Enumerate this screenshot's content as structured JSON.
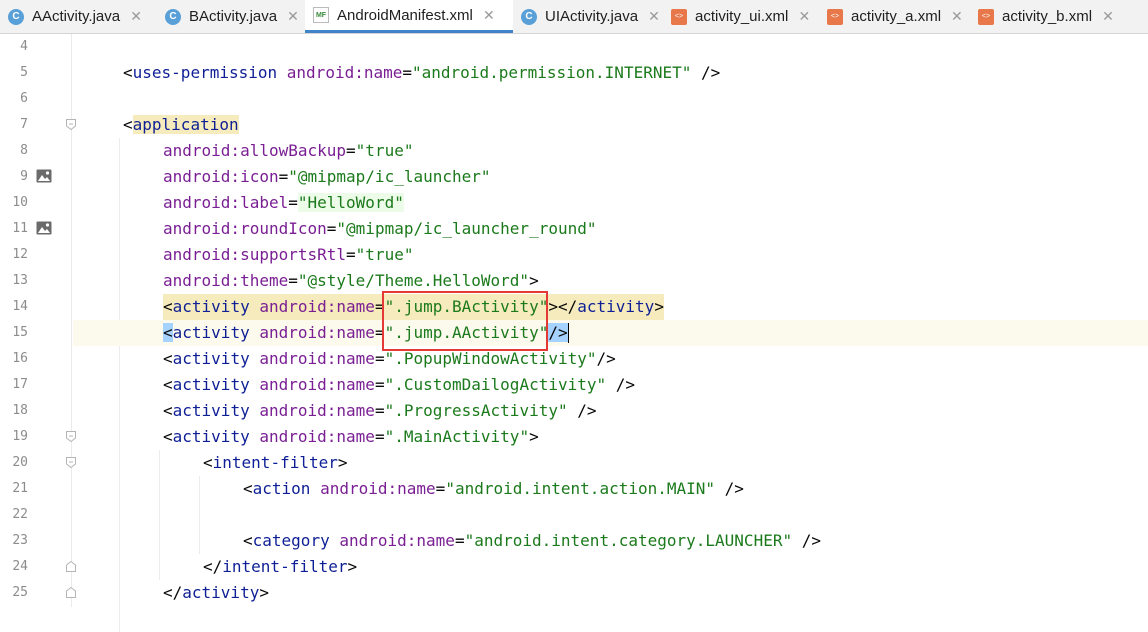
{
  "tabs": [
    {
      "label": "AActivity.java",
      "icon": "java-class-icon",
      "active": false
    },
    {
      "label": "BActivity.java",
      "icon": "java-class-icon",
      "active": false
    },
    {
      "label": "AndroidManifest.xml",
      "icon": "manifest-icon",
      "active": true
    },
    {
      "label": "UIActivity.java",
      "icon": "java-class-icon",
      "active": false
    },
    {
      "label": "activity_ui.xml",
      "icon": "xml-layout-icon",
      "active": false
    },
    {
      "label": "activity_a.xml",
      "icon": "xml-layout-icon",
      "active": false
    },
    {
      "label": "activity_b.xml",
      "icon": "xml-layout-icon",
      "active": false
    }
  ],
  "tab_icon_text": {
    "java": "C",
    "xml": "<>",
    "manifest": "MF"
  },
  "close_glyph": "✕",
  "editor": {
    "lines": [
      {
        "n": "4"
      },
      {
        "n": "5",
        "indent": 1,
        "parts": [
          [
            "p",
            "<"
          ],
          [
            "tag",
            "uses-permission"
          ],
          [
            "p",
            " "
          ],
          [
            "ns",
            "android:"
          ],
          [
            "attr",
            "name"
          ],
          [
            "p",
            "="
          ],
          [
            "val",
            "\"android.permission.INTERNET\""
          ],
          [
            "p",
            " />"
          ]
        ]
      },
      {
        "n": "6"
      },
      {
        "n": "7",
        "indent": 1,
        "fold": "open",
        "parts": [
          [
            "p",
            "<"
          ],
          [
            "tag",
            "application",
            "app"
          ]
        ]
      },
      {
        "n": "8",
        "indent": 2,
        "parts": [
          [
            "ns",
            "android:"
          ],
          [
            "attr",
            "allowBackup"
          ],
          [
            "p",
            "="
          ],
          [
            "val",
            "\"true\""
          ]
        ]
      },
      {
        "n": "9",
        "indent": 2,
        "icon": "image-icon",
        "parts": [
          [
            "ns",
            "android:"
          ],
          [
            "attr",
            "icon"
          ],
          [
            "p",
            "="
          ],
          [
            "val",
            "\"@mipmap/ic_launcher\""
          ]
        ]
      },
      {
        "n": "10",
        "indent": 2,
        "parts": [
          [
            "ns",
            "android:"
          ],
          [
            "attr",
            "label"
          ],
          [
            "p",
            "="
          ],
          [
            "val",
            "\"HelloWord\"",
            "label"
          ]
        ]
      },
      {
        "n": "11",
        "indent": 2,
        "icon": "image-icon",
        "parts": [
          [
            "ns",
            "android:"
          ],
          [
            "attr",
            "roundIcon"
          ],
          [
            "p",
            "="
          ],
          [
            "val",
            "\"@mipmap/ic_launcher_round\""
          ]
        ]
      },
      {
        "n": "12",
        "indent": 2,
        "parts": [
          [
            "ns",
            "android:"
          ],
          [
            "attr",
            "supportsRtl"
          ],
          [
            "p",
            "="
          ],
          [
            "val",
            "\"true\""
          ]
        ]
      },
      {
        "n": "13",
        "indent": 2,
        "parts": [
          [
            "ns",
            "android:"
          ],
          [
            "attr",
            "theme"
          ],
          [
            "p",
            "="
          ],
          [
            "val",
            "\"@style/Theme.HelloWord\""
          ],
          [
            "p",
            ">"
          ]
        ]
      },
      {
        "n": "14",
        "indent": 2,
        "hl": "act",
        "parts": [
          [
            "p",
            "<"
          ],
          [
            "tag",
            "activity"
          ],
          [
            "p",
            " "
          ],
          [
            "ns",
            "android:"
          ],
          [
            "attr",
            "name"
          ],
          [
            "p",
            "="
          ],
          [
            "val",
            "\".jump.BActivity\""
          ],
          [
            "p",
            "></"
          ],
          [
            "tag",
            "activity"
          ],
          [
            "p",
            ">"
          ]
        ]
      },
      {
        "n": "15",
        "indent": 2,
        "caret": true,
        "parts": [
          [
            "p",
            "<",
            "caret"
          ],
          [
            "tag",
            "activity"
          ],
          [
            "p",
            " "
          ],
          [
            "ns",
            "android:"
          ],
          [
            "attr",
            "name"
          ],
          [
            "p",
            "="
          ],
          [
            "val",
            "\".jump.AActivity\""
          ],
          [
            "p",
            "/>",
            "caret"
          ]
        ]
      },
      {
        "n": "16",
        "indent": 2,
        "parts": [
          [
            "p",
            "<"
          ],
          [
            "tag",
            "activity"
          ],
          [
            "p",
            " "
          ],
          [
            "ns",
            "android:"
          ],
          [
            "attr",
            "name"
          ],
          [
            "p",
            "="
          ],
          [
            "val",
            "\".PopupWindowActivity\""
          ],
          [
            "p",
            "/>"
          ]
        ]
      },
      {
        "n": "17",
        "indent": 2,
        "parts": [
          [
            "p",
            "<"
          ],
          [
            "tag",
            "activity"
          ],
          [
            "p",
            " "
          ],
          [
            "ns",
            "android:"
          ],
          [
            "attr",
            "name"
          ],
          [
            "p",
            "="
          ],
          [
            "val",
            "\".CustomDailogActivity\""
          ],
          [
            "p",
            " />"
          ]
        ]
      },
      {
        "n": "18",
        "indent": 2,
        "parts": [
          [
            "p",
            "<"
          ],
          [
            "tag",
            "activity"
          ],
          [
            "p",
            " "
          ],
          [
            "ns",
            "android:"
          ],
          [
            "attr",
            "name"
          ],
          [
            "p",
            "="
          ],
          [
            "val",
            "\".ProgressActivity\""
          ],
          [
            "p",
            " />"
          ]
        ]
      },
      {
        "n": "19",
        "indent": 2,
        "fold": "open",
        "parts": [
          [
            "p",
            "<"
          ],
          [
            "tag",
            "activity"
          ],
          [
            "p",
            " "
          ],
          [
            "ns",
            "android:"
          ],
          [
            "attr",
            "name"
          ],
          [
            "p",
            "="
          ],
          [
            "val",
            "\".MainActivity\""
          ],
          [
            "p",
            ">"
          ]
        ]
      },
      {
        "n": "20",
        "indent": 3,
        "fold": "open",
        "parts": [
          [
            "p",
            "<"
          ],
          [
            "tag",
            "intent-filter"
          ],
          [
            "p",
            ">"
          ]
        ]
      },
      {
        "n": "21",
        "indent": 4,
        "parts": [
          [
            "p",
            "<"
          ],
          [
            "tag",
            "action"
          ],
          [
            "p",
            " "
          ],
          [
            "ns",
            "android:"
          ],
          [
            "attr",
            "name"
          ],
          [
            "p",
            "="
          ],
          [
            "val",
            "\"android.intent.action.MAIN\""
          ],
          [
            "p",
            " />"
          ]
        ]
      },
      {
        "n": "22"
      },
      {
        "n": "23",
        "indent": 4,
        "parts": [
          [
            "p",
            "<"
          ],
          [
            "tag",
            "category"
          ],
          [
            "p",
            " "
          ],
          [
            "ns",
            "android:"
          ],
          [
            "attr",
            "name"
          ],
          [
            "p",
            "="
          ],
          [
            "val",
            "\"android.intent.category.LAUNCHER\""
          ],
          [
            "p",
            " />"
          ]
        ]
      },
      {
        "n": "24",
        "indent": 3,
        "fold": "close",
        "parts": [
          [
            "p",
            "</"
          ],
          [
            "tag",
            "intent-filter"
          ],
          [
            "p",
            ">"
          ]
        ]
      },
      {
        "n": "25",
        "indent": 2,
        "fold": "close",
        "parts": [
          [
            "p",
            "</"
          ],
          [
            "tag",
            "activity"
          ],
          [
            "p",
            ">"
          ]
        ]
      }
    ]
  },
  "colors": {
    "tag": "#0e1f96",
    "attr": "#7a1f93",
    "value": "#1b7a1b",
    "highlight_box": "#e53935",
    "active_tab_underline": "#4083c9"
  }
}
